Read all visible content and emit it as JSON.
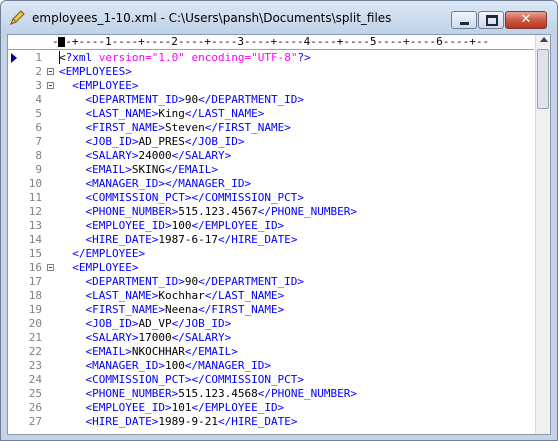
{
  "window": {
    "title": "employees_1-10.xml - C:\\Users\\pansh\\Documents\\split_files",
    "icon": "pencil-icon",
    "buttons": {
      "minimize": "minimize-icon",
      "maximize": "maximize-icon",
      "close": "close-icon"
    }
  },
  "ruler": {
    "text": "---+----1----+----2----+----3----+----4----+----5----+----6----+--"
  },
  "editor": {
    "lines": [
      {
        "n": "1",
        "fold": false,
        "indent": "",
        "parts": [
          {
            "c": "text",
            "t": "<"
          },
          {
            "c": "tag",
            "t": "?xml "
          },
          {
            "c": "kw",
            "t": "version="
          },
          {
            "c": "kw",
            "t": "\"1.0\""
          },
          {
            "c": "tag",
            "t": " "
          },
          {
            "c": "kw",
            "t": "encoding="
          },
          {
            "c": "kw",
            "t": "\"UTF-8\""
          },
          {
            "c": "tag",
            "t": "?>"
          }
        ]
      },
      {
        "n": "2",
        "fold": true,
        "indent": "",
        "parts": [
          {
            "c": "tag",
            "t": "<EMPLOYEES>"
          }
        ]
      },
      {
        "n": "3",
        "fold": true,
        "indent": "  ",
        "parts": [
          {
            "c": "tag",
            "t": "<EMPLOYEE>"
          }
        ]
      },
      {
        "n": "4",
        "fold": false,
        "indent": "    ",
        "parts": [
          {
            "c": "tag",
            "t": "<DEPARTMENT_ID>"
          },
          {
            "c": "text",
            "t": "90"
          },
          {
            "c": "tag",
            "t": "</DEPARTMENT_ID>"
          }
        ]
      },
      {
        "n": "5",
        "fold": false,
        "indent": "    ",
        "parts": [
          {
            "c": "tag",
            "t": "<LAST_NAME>"
          },
          {
            "c": "text",
            "t": "King"
          },
          {
            "c": "tag",
            "t": "</LAST_NAME>"
          }
        ]
      },
      {
        "n": "6",
        "fold": false,
        "indent": "    ",
        "parts": [
          {
            "c": "tag",
            "t": "<FIRST_NAME>"
          },
          {
            "c": "text",
            "t": "Steven"
          },
          {
            "c": "tag",
            "t": "</FIRST_NAME>"
          }
        ]
      },
      {
        "n": "7",
        "fold": false,
        "indent": "    ",
        "parts": [
          {
            "c": "tag",
            "t": "<JOB_ID>"
          },
          {
            "c": "text",
            "t": "AD_PRES"
          },
          {
            "c": "tag",
            "t": "</JOB_ID>"
          }
        ]
      },
      {
        "n": "8",
        "fold": false,
        "indent": "    ",
        "parts": [
          {
            "c": "tag",
            "t": "<SALARY>"
          },
          {
            "c": "text",
            "t": "24000"
          },
          {
            "c": "tag",
            "t": "</SALARY>"
          }
        ]
      },
      {
        "n": "9",
        "fold": false,
        "indent": "    ",
        "parts": [
          {
            "c": "tag",
            "t": "<EMAIL>"
          },
          {
            "c": "text",
            "t": "SKING"
          },
          {
            "c": "tag",
            "t": "</EMAIL>"
          }
        ]
      },
      {
        "n": "10",
        "fold": false,
        "indent": "    ",
        "parts": [
          {
            "c": "tag",
            "t": "<MANAGER_ID>"
          },
          {
            "c": "tag",
            "t": "</MANAGER_ID>"
          }
        ]
      },
      {
        "n": "11",
        "fold": false,
        "indent": "    ",
        "parts": [
          {
            "c": "tag",
            "t": "<COMMISSION_PCT>"
          },
          {
            "c": "tag",
            "t": "</COMMISSION_PCT>"
          }
        ]
      },
      {
        "n": "12",
        "fold": false,
        "indent": "    ",
        "parts": [
          {
            "c": "tag",
            "t": "<PHONE_NUMBER>"
          },
          {
            "c": "text",
            "t": "515.123.4567"
          },
          {
            "c": "tag",
            "t": "</PHONE_NUMBER>"
          }
        ]
      },
      {
        "n": "13",
        "fold": false,
        "indent": "    ",
        "parts": [
          {
            "c": "tag",
            "t": "<EMPLOYEE_ID>"
          },
          {
            "c": "text",
            "t": "100"
          },
          {
            "c": "tag",
            "t": "</EMPLOYEE_ID>"
          }
        ]
      },
      {
        "n": "14",
        "fold": false,
        "indent": "    ",
        "parts": [
          {
            "c": "tag",
            "t": "<HIRE_DATE>"
          },
          {
            "c": "text",
            "t": "1987-6-17"
          },
          {
            "c": "tag",
            "t": "</HIRE_DATE>"
          }
        ]
      },
      {
        "n": "15",
        "fold": false,
        "indent": "  ",
        "parts": [
          {
            "c": "tag",
            "t": "</EMPLOYEE>"
          }
        ]
      },
      {
        "n": "16",
        "fold": true,
        "indent": "  ",
        "parts": [
          {
            "c": "tag",
            "t": "<EMPLOYEE>"
          }
        ]
      },
      {
        "n": "17",
        "fold": false,
        "indent": "    ",
        "parts": [
          {
            "c": "tag",
            "t": "<DEPARTMENT_ID>"
          },
          {
            "c": "text",
            "t": "90"
          },
          {
            "c": "tag",
            "t": "</DEPARTMENT_ID>"
          }
        ]
      },
      {
        "n": "18",
        "fold": false,
        "indent": "    ",
        "parts": [
          {
            "c": "tag",
            "t": "<LAST_NAME>"
          },
          {
            "c": "text",
            "t": "Kochhar"
          },
          {
            "c": "tag",
            "t": "</LAST_NAME>"
          }
        ]
      },
      {
        "n": "19",
        "fold": false,
        "indent": "    ",
        "parts": [
          {
            "c": "tag",
            "t": "<FIRST_NAME>"
          },
          {
            "c": "text",
            "t": "Neena"
          },
          {
            "c": "tag",
            "t": "</FIRST_NAME>"
          }
        ]
      },
      {
        "n": "20",
        "fold": false,
        "indent": "    ",
        "parts": [
          {
            "c": "tag",
            "t": "<JOB_ID>"
          },
          {
            "c": "text",
            "t": "AD_VP"
          },
          {
            "c": "tag",
            "t": "</JOB_ID>"
          }
        ]
      },
      {
        "n": "21",
        "fold": false,
        "indent": "    ",
        "parts": [
          {
            "c": "tag",
            "t": "<SALARY>"
          },
          {
            "c": "text",
            "t": "17000"
          },
          {
            "c": "tag",
            "t": "</SALARY>"
          }
        ]
      },
      {
        "n": "22",
        "fold": false,
        "indent": "    ",
        "parts": [
          {
            "c": "tag",
            "t": "<EMAIL>"
          },
          {
            "c": "text",
            "t": "NKOCHHAR"
          },
          {
            "c": "tag",
            "t": "</EMAIL>"
          }
        ]
      },
      {
        "n": "23",
        "fold": false,
        "indent": "    ",
        "parts": [
          {
            "c": "tag",
            "t": "<MANAGER_ID>"
          },
          {
            "c": "text",
            "t": "100"
          },
          {
            "c": "tag",
            "t": "</MANAGER_ID>"
          }
        ]
      },
      {
        "n": "24",
        "fold": false,
        "indent": "    ",
        "parts": [
          {
            "c": "tag",
            "t": "<COMMISSION_PCT>"
          },
          {
            "c": "tag",
            "t": "</COMMISSION_PCT>"
          }
        ]
      },
      {
        "n": "25",
        "fold": false,
        "indent": "    ",
        "parts": [
          {
            "c": "tag",
            "t": "<PHONE_NUMBER>"
          },
          {
            "c": "text",
            "t": "515.123.4568"
          },
          {
            "c": "tag",
            "t": "</PHONE_NUMBER>"
          }
        ]
      },
      {
        "n": "26",
        "fold": false,
        "indent": "    ",
        "parts": [
          {
            "c": "tag",
            "t": "<EMPLOYEE_ID>"
          },
          {
            "c": "text",
            "t": "101"
          },
          {
            "c": "tag",
            "t": "</EMPLOYEE_ID>"
          }
        ]
      },
      {
        "n": "27",
        "fold": false,
        "indent": "    ",
        "parts": [
          {
            "c": "tag",
            "t": "<HIRE_DATE>"
          },
          {
            "c": "text",
            "t": "1989-9-21"
          },
          {
            "c": "tag",
            "t": "</HIRE_DATE>"
          }
        ]
      }
    ]
  },
  "colors": {
    "tag": "#0000ff",
    "attr": "#ff00ff",
    "text": "#000000",
    "line_number": "#808080"
  }
}
